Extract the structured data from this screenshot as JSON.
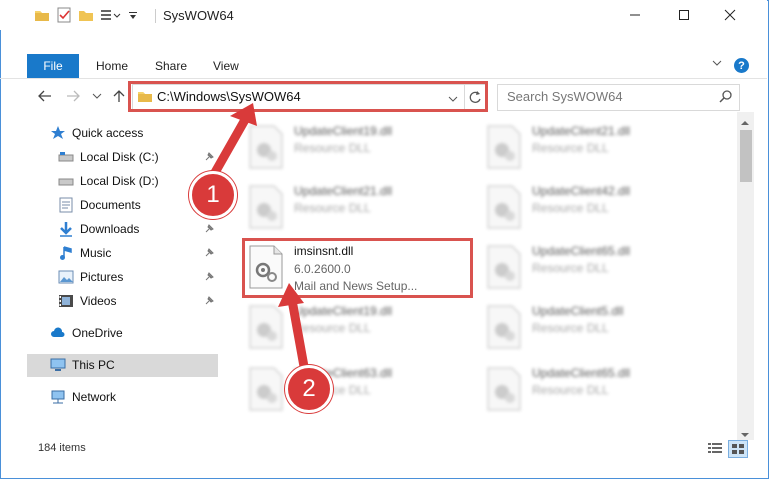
{
  "window": {
    "title": "SysWOW64"
  },
  "ribbon": {
    "file": "File",
    "tabs": [
      "Home",
      "Share",
      "View"
    ]
  },
  "address": {
    "path": "C:\\Windows\\SysWOW64"
  },
  "search": {
    "placeholder": "Search SysWOW64"
  },
  "nav": {
    "quick_access": "Quick access",
    "items": [
      "Local Disk (C:)",
      "Local Disk (D:)",
      "Documents",
      "Downloads",
      "Music",
      "Pictures",
      "Videos"
    ],
    "onedrive": "OneDrive",
    "this_pc": "This PC",
    "network": "Network"
  },
  "files": {
    "left": [
      {
        "name": "UpdateClient19.dll",
        "type": "Resource DLL"
      },
      {
        "name": "UpdateClient21.dll",
        "type": "Resource DLL"
      },
      {
        "name": "UpdateClient19.dll",
        "type": "Resource DLL"
      },
      {
        "name": "UpdateClient63.dll",
        "type": "Resource DLL"
      }
    ],
    "right": [
      {
        "name": "UpdateClient21.dll",
        "type": "Resource DLL"
      },
      {
        "name": "UpdateClient42.dll",
        "type": "Resource DLL"
      },
      {
        "name": "UpdateClient65.dll",
        "type": "Resource DLL"
      },
      {
        "name": "UpdateClient5.dll",
        "type": "Resource DLL"
      },
      {
        "name": "UpdateClient65.dll",
        "type": "Resource DLL"
      }
    ],
    "highlighted": {
      "name": "imsinsnt.dll",
      "version": "6.0.2600.0",
      "description": "Mail and News Setup..."
    }
  },
  "status": {
    "count": "184 items"
  },
  "annotations": {
    "step1": "1",
    "step2": "2",
    "color": "#d9534f"
  }
}
